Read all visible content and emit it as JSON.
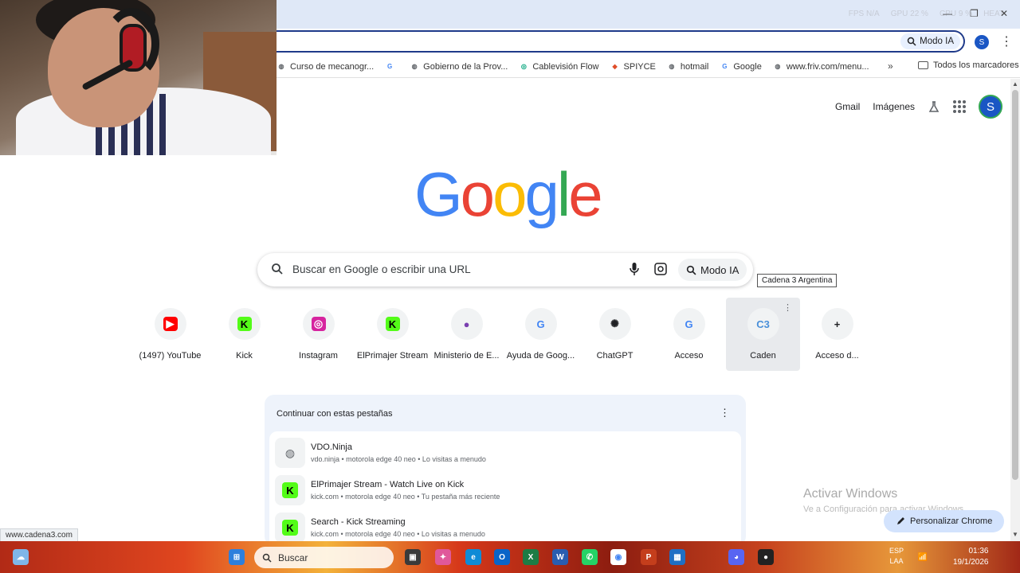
{
  "perf_overlay": {
    "fps": "FPS N/A",
    "gpu": "GPU 22 %",
    "cpu": "CPU 9 %",
    "heat": "HEAT"
  },
  "toolbar": {
    "modo_ia": "Modo IA",
    "avatar_letter": "S"
  },
  "bookmarks": {
    "items": [
      {
        "label": "Curso de mecanogr...",
        "icon": "globe-icon",
        "color": "#5f6368"
      },
      {
        "label": "",
        "icon": "google-icon",
        "color": "#4285f4"
      },
      {
        "label": "Gobierno de la Prov...",
        "icon": "globe-icon",
        "color": "#5f6368"
      },
      {
        "label": "Cablevisión Flow",
        "icon": "flow-icon",
        "color": "#00a37a"
      },
      {
        "label": "SPIYCE",
        "icon": "spiyce-icon",
        "color": "#e04e2a"
      },
      {
        "label": "hotmail",
        "icon": "globe-icon",
        "color": "#5f6368"
      },
      {
        "label": "Google",
        "icon": "google-icon",
        "color": "#4285f4"
      },
      {
        "label": "www.friv.com/menu...",
        "icon": "globe-icon",
        "color": "#5f6368"
      }
    ],
    "all_label": "Todos los marcadores"
  },
  "header_links": {
    "gmail": "Gmail",
    "images": "Imágenes",
    "avatar_letter": "S"
  },
  "logo": [
    "G",
    "o",
    "o",
    "g",
    "l",
    "e"
  ],
  "logo_colors": [
    "#4285f4",
    "#ea4335",
    "#fbbc05",
    "#4285f4",
    "#34a853",
    "#ea4335"
  ],
  "search": {
    "placeholder": "Buscar en Google o escribir una URL",
    "modo_ia": "Modo IA"
  },
  "shortcuts": [
    {
      "label": "(1497) YouTube",
      "icon": "youtube-icon",
      "glyph": "▶",
      "bg": "#ff0000",
      "fg": "#fff"
    },
    {
      "label": "Kick",
      "icon": "kick-icon",
      "glyph": "K",
      "bg": "#53fc18",
      "fg": "#000"
    },
    {
      "label": "Instagram",
      "icon": "instagram-icon",
      "glyph": "◎",
      "bg": "#d6249f",
      "fg": "#fff"
    },
    {
      "label": "ElPrimajer Stream",
      "icon": "kick-icon",
      "glyph": "K",
      "bg": "#53fc18",
      "fg": "#000"
    },
    {
      "label": "Ministerio de E...",
      "icon": "ministerio-icon",
      "glyph": "●",
      "bg": "#f1f3f4",
      "fg": "#7a3fb0"
    },
    {
      "label": "Ayuda de Goog...",
      "icon": "google-icon",
      "glyph": "G",
      "bg": "#f1f3f4",
      "fg": "#4285f4"
    },
    {
      "label": "ChatGPT",
      "icon": "chatgpt-icon",
      "glyph": "✺",
      "bg": "#f1f3f4",
      "fg": "#202124"
    },
    {
      "label": "Acceso",
      "icon": "google-icon",
      "glyph": "G",
      "bg": "#f1f3f4",
      "fg": "#4285f4"
    },
    {
      "label": "Cadena 3 Argentina",
      "icon": "cadena3-icon",
      "glyph": "C3",
      "bg": "#f1f3f4",
      "fg": "#4a90d9"
    },
    {
      "label": "Acceso d...",
      "icon": "plus-icon",
      "glyph": "+",
      "bg": "#f1f3f4",
      "fg": "#202124"
    }
  ],
  "tooltip": "Cadena 3 Argentina",
  "continue": {
    "header": "Continuar con estas pestañas",
    "tabs": [
      {
        "title": "VDO.Ninja",
        "meta": "vdo.ninja • motorola edge 40 neo • Lo visitas a menudo",
        "icon": "globe-icon"
      },
      {
        "title": "ElPrimajer Stream - Watch Live on Kick",
        "meta": "kick.com • motorola edge 40 neo • Tu pestaña más reciente",
        "icon": "kick-icon"
      },
      {
        "title": "Search - Kick Streaming",
        "meta": "kick.com • motorola edge 40 neo • Lo visitas a menudo",
        "icon": "kick-icon"
      }
    ]
  },
  "windows": {
    "activate_title": "Activar Windows",
    "activate_sub": "Ve a Configuración para activar Windows."
  },
  "personalize": "Personalizar Chrome",
  "status_url": "www.cadena3.com",
  "taskbar": {
    "search_label": "Buscar",
    "lang": "ESP",
    "lang2": "LAA",
    "time": "01:36",
    "date": "19/1/2026"
  }
}
